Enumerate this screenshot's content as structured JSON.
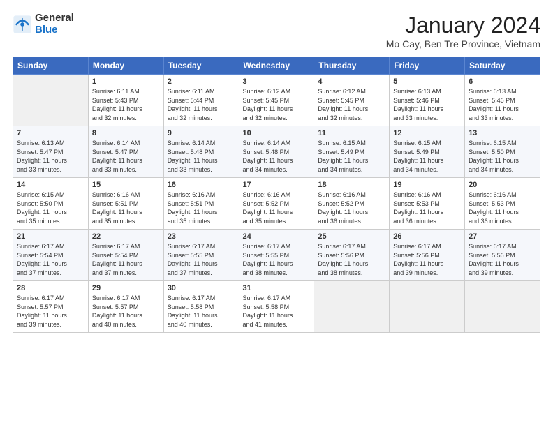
{
  "header": {
    "logo_general": "General",
    "logo_blue": "Blue",
    "title": "January 2024",
    "subtitle": "Mo Cay, Ben Tre Province, Vietnam"
  },
  "days_of_week": [
    "Sunday",
    "Monday",
    "Tuesday",
    "Wednesday",
    "Thursday",
    "Friday",
    "Saturday"
  ],
  "weeks": [
    [
      {
        "num": "",
        "info": ""
      },
      {
        "num": "1",
        "info": "Sunrise: 6:11 AM\nSunset: 5:43 PM\nDaylight: 11 hours\nand 32 minutes."
      },
      {
        "num": "2",
        "info": "Sunrise: 6:11 AM\nSunset: 5:44 PM\nDaylight: 11 hours\nand 32 minutes."
      },
      {
        "num": "3",
        "info": "Sunrise: 6:12 AM\nSunset: 5:45 PM\nDaylight: 11 hours\nand 32 minutes."
      },
      {
        "num": "4",
        "info": "Sunrise: 6:12 AM\nSunset: 5:45 PM\nDaylight: 11 hours\nand 32 minutes."
      },
      {
        "num": "5",
        "info": "Sunrise: 6:13 AM\nSunset: 5:46 PM\nDaylight: 11 hours\nand 33 minutes."
      },
      {
        "num": "6",
        "info": "Sunrise: 6:13 AM\nSunset: 5:46 PM\nDaylight: 11 hours\nand 33 minutes."
      }
    ],
    [
      {
        "num": "7",
        "info": "Sunrise: 6:13 AM\nSunset: 5:47 PM\nDaylight: 11 hours\nand 33 minutes."
      },
      {
        "num": "8",
        "info": "Sunrise: 6:14 AM\nSunset: 5:47 PM\nDaylight: 11 hours\nand 33 minutes."
      },
      {
        "num": "9",
        "info": "Sunrise: 6:14 AM\nSunset: 5:48 PM\nDaylight: 11 hours\nand 33 minutes."
      },
      {
        "num": "10",
        "info": "Sunrise: 6:14 AM\nSunset: 5:48 PM\nDaylight: 11 hours\nand 34 minutes."
      },
      {
        "num": "11",
        "info": "Sunrise: 6:15 AM\nSunset: 5:49 PM\nDaylight: 11 hours\nand 34 minutes."
      },
      {
        "num": "12",
        "info": "Sunrise: 6:15 AM\nSunset: 5:49 PM\nDaylight: 11 hours\nand 34 minutes."
      },
      {
        "num": "13",
        "info": "Sunrise: 6:15 AM\nSunset: 5:50 PM\nDaylight: 11 hours\nand 34 minutes."
      }
    ],
    [
      {
        "num": "14",
        "info": "Sunrise: 6:15 AM\nSunset: 5:50 PM\nDaylight: 11 hours\nand 35 minutes."
      },
      {
        "num": "15",
        "info": "Sunrise: 6:16 AM\nSunset: 5:51 PM\nDaylight: 11 hours\nand 35 minutes."
      },
      {
        "num": "16",
        "info": "Sunrise: 6:16 AM\nSunset: 5:51 PM\nDaylight: 11 hours\nand 35 minutes."
      },
      {
        "num": "17",
        "info": "Sunrise: 6:16 AM\nSunset: 5:52 PM\nDaylight: 11 hours\nand 35 minutes."
      },
      {
        "num": "18",
        "info": "Sunrise: 6:16 AM\nSunset: 5:52 PM\nDaylight: 11 hours\nand 36 minutes."
      },
      {
        "num": "19",
        "info": "Sunrise: 6:16 AM\nSunset: 5:53 PM\nDaylight: 11 hours\nand 36 minutes."
      },
      {
        "num": "20",
        "info": "Sunrise: 6:16 AM\nSunset: 5:53 PM\nDaylight: 11 hours\nand 36 minutes."
      }
    ],
    [
      {
        "num": "21",
        "info": "Sunrise: 6:17 AM\nSunset: 5:54 PM\nDaylight: 11 hours\nand 37 minutes."
      },
      {
        "num": "22",
        "info": "Sunrise: 6:17 AM\nSunset: 5:54 PM\nDaylight: 11 hours\nand 37 minutes."
      },
      {
        "num": "23",
        "info": "Sunrise: 6:17 AM\nSunset: 5:55 PM\nDaylight: 11 hours\nand 37 minutes."
      },
      {
        "num": "24",
        "info": "Sunrise: 6:17 AM\nSunset: 5:55 PM\nDaylight: 11 hours\nand 38 minutes."
      },
      {
        "num": "25",
        "info": "Sunrise: 6:17 AM\nSunset: 5:56 PM\nDaylight: 11 hours\nand 38 minutes."
      },
      {
        "num": "26",
        "info": "Sunrise: 6:17 AM\nSunset: 5:56 PM\nDaylight: 11 hours\nand 39 minutes."
      },
      {
        "num": "27",
        "info": "Sunrise: 6:17 AM\nSunset: 5:56 PM\nDaylight: 11 hours\nand 39 minutes."
      }
    ],
    [
      {
        "num": "28",
        "info": "Sunrise: 6:17 AM\nSunset: 5:57 PM\nDaylight: 11 hours\nand 39 minutes."
      },
      {
        "num": "29",
        "info": "Sunrise: 6:17 AM\nSunset: 5:57 PM\nDaylight: 11 hours\nand 40 minutes."
      },
      {
        "num": "30",
        "info": "Sunrise: 6:17 AM\nSunset: 5:58 PM\nDaylight: 11 hours\nand 40 minutes."
      },
      {
        "num": "31",
        "info": "Sunrise: 6:17 AM\nSunset: 5:58 PM\nDaylight: 11 hours\nand 41 minutes."
      },
      {
        "num": "",
        "info": ""
      },
      {
        "num": "",
        "info": ""
      },
      {
        "num": "",
        "info": ""
      }
    ]
  ]
}
